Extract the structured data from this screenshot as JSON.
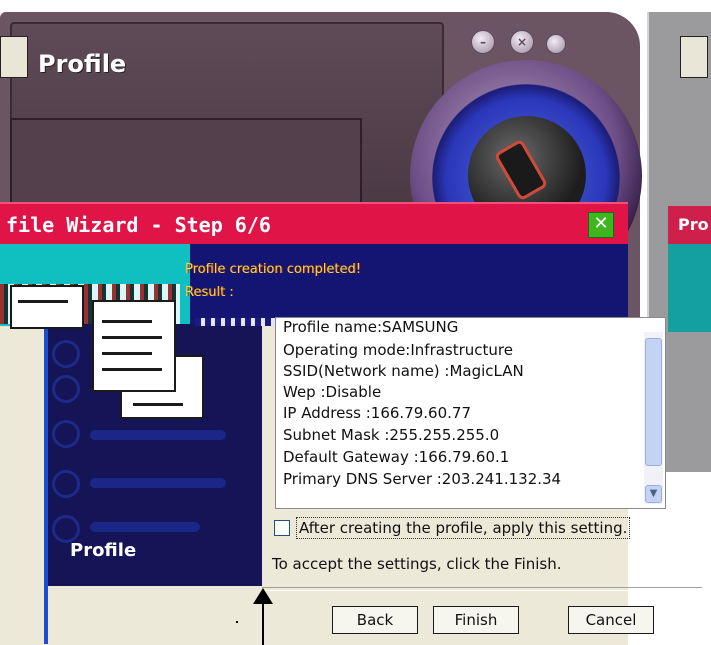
{
  "app": {
    "title": "Profile",
    "right_title": "Pro",
    "side_label": "Profile"
  },
  "wizard": {
    "title": "file Wizard - Step 6/6",
    "close_label": "✕",
    "header_line1": "Profile creation completed!",
    "header_line2": "Result :",
    "result_lines": [
      "Profile name:SAMSUNG",
      "Operating mode:Infrastructure",
      "SSID(Network name) :MagicLAN",
      "Wep :Disable",
      "IP Address :166.79.60.77",
      "Subnet Mask :255.255.255.0",
      "Default Gateway :166.79.60.1",
      "Primary DNS Server :203.241.132.34"
    ],
    "apply_checkbox_label": "After creating the profile, apply this setting.",
    "apply_checked": false,
    "instruction": "To accept the settings, click the Finish.",
    "buttons": {
      "back": "Back",
      "finish": "Finish",
      "cancel": "Cancel"
    }
  },
  "icons": {
    "minimize": "minimize-icon",
    "close": "close-icon",
    "scroll_down": "chevron-down-icon",
    "annotation": "arrow-up-icon"
  },
  "colors": {
    "titlebar": "#e01446",
    "header_band": "#141472",
    "accent_teal": "#10c0c0",
    "sidebar": "#141456"
  }
}
